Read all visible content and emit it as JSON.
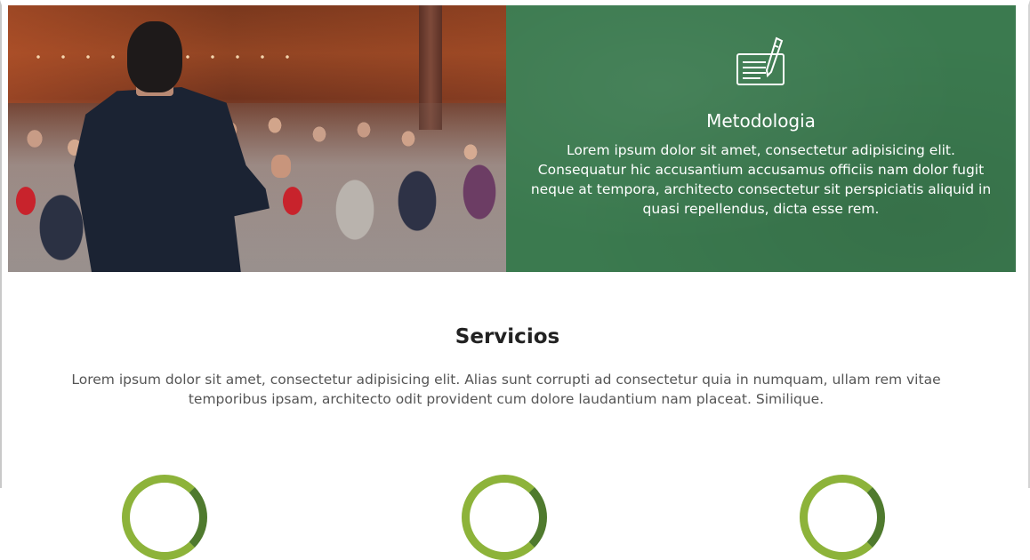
{
  "hero": {
    "panel": {
      "icon": "contract-pen-icon",
      "title": "Metodologia",
      "text": "Lorem ipsum dolor sit amet, consectetur adipisicing elit. Consequatur hic accusantium accusamus officiis nam dolor fugit neque at tempora, architecto consectetur sit perspiciatis aliquid in quasi repellendus, dicta esse rem."
    },
    "colors": {
      "panel_green": "#3b7a4f"
    }
  },
  "services": {
    "title": "Servicios",
    "text": "Lorem ipsum dolor sit amet, consectetur adipisicing elit. Alias sunt corrupti ad consectetur quia in numquam, ullam rem vitae temporibus ipsam, architecto odit provident cum dolore laudantium nam placeat. Similique.",
    "items": [
      {
        "icon": "service-ring-icon"
      },
      {
        "icon": "service-ring-icon"
      },
      {
        "icon": "service-ring-icon"
      }
    ],
    "colors": {
      "ring_light": "#8db33a",
      "ring_dark": "#4f7a2e"
    }
  }
}
